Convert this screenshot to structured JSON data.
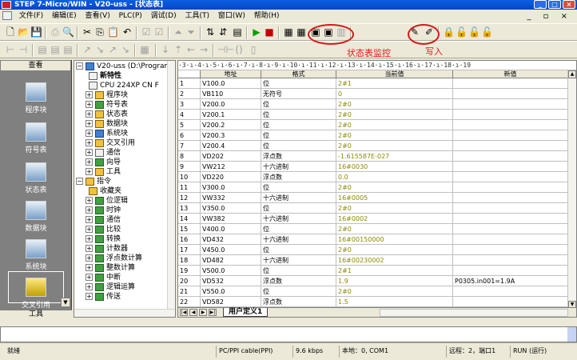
{
  "window": {
    "title": "STEP 7-Micro/WIN - V20-uss - [状态表]"
  },
  "menu": [
    "文件(F)",
    "编辑(E)",
    "查看(V)",
    "PLC(P)",
    "调试(D)",
    "工具(T)",
    "窗口(W)",
    "帮助(H)"
  ],
  "annotations": {
    "status_monitor": "状态表监控",
    "write": "写入"
  },
  "nav": {
    "header": "查看",
    "items": [
      "程序块",
      "符号表",
      "状态表",
      "数据块",
      "系统块",
      "交叉引用"
    ],
    "footer": "工具"
  },
  "tree": {
    "root": "V20-uss (D:\\Program",
    "items": [
      "新特性",
      "CPU 224XP CN F",
      "程序块",
      "符号表",
      "状态表",
      "数据块",
      "系统块",
      "交叉引用",
      "通信",
      "向导",
      "工具",
      "指令",
      "收藏夹",
      "位逻辑",
      "时钟",
      "通信",
      "比较",
      "转换",
      "计数器",
      "浮点数计算",
      "整数计算",
      "中断",
      "逻辑运算",
      "传送"
    ]
  },
  "ruler": "·3·ı·4·ı·5·ı·6·ı·7·ı·8·ı·9·ı·10·ı·11·ı·12·ı·13·ı·14·ı·15·ı·16·ı·17·ı·18·ı·19",
  "table": {
    "headers": [
      "",
      "地址",
      "格式",
      "当前值",
      "新值"
    ],
    "rows": [
      [
        "1",
        "V100.0",
        "位",
        "2#1",
        ""
      ],
      [
        "2",
        "VB110",
        "无符号",
        "0",
        ""
      ],
      [
        "3",
        "V200.0",
        "位",
        "2#0",
        ""
      ],
      [
        "4",
        "V200.1",
        "位",
        "2#0",
        ""
      ],
      [
        "5",
        "V200.2",
        "位",
        "2#0",
        ""
      ],
      [
        "6",
        "V200.3",
        "位",
        "2#0",
        ""
      ],
      [
        "7",
        "V200.4",
        "位",
        "2#0",
        ""
      ],
      [
        "8",
        "VD202",
        "浮点数",
        "-1.615587E-027",
        ""
      ],
      [
        "9",
        "VW212",
        "十六进制",
        "16#0030",
        ""
      ],
      [
        "10",
        "VD220",
        "浮点数",
        "0.0",
        ""
      ],
      [
        "11",
        "V300.0",
        "位",
        "2#0",
        ""
      ],
      [
        "12",
        "VW332",
        "十六进制",
        "16#0005",
        ""
      ],
      [
        "13",
        "V350.0",
        "位",
        "2#0",
        ""
      ],
      [
        "14",
        "VW382",
        "十六进制",
        "16#0002",
        ""
      ],
      [
        "15",
        "V400.0",
        "位",
        "2#0",
        ""
      ],
      [
        "16",
        "VD432",
        "十六进制",
        "16#00150000",
        ""
      ],
      [
        "17",
        "V450.0",
        "位",
        "2#0",
        ""
      ],
      [
        "18",
        "VD482",
        "十六进制",
        "16#00230002",
        ""
      ],
      [
        "19",
        "V500.0",
        "位",
        "2#1",
        ""
      ],
      [
        "20",
        "VD532",
        "浮点数",
        "1.9",
        "P0305.in001=1.9A"
      ],
      [
        "21",
        "V550.0",
        "位",
        "2#0",
        ""
      ],
      [
        "22",
        "VD582",
        "浮点数",
        "1.5",
        ""
      ]
    ]
  },
  "tab": {
    "label": "用户定义1"
  },
  "status": {
    "ready": "就绪",
    "cable": "PC/PPI cable(PPI)",
    "baud": "9.6 kbps",
    "local": "本地：0, COM1",
    "remote": "远程：2，端口1",
    "mode": "RUN (运行)"
  },
  "colors": {
    "title_bar": "#0a5fe0",
    "annotation_red": "#d81818",
    "value_text": "#8a8a00"
  }
}
